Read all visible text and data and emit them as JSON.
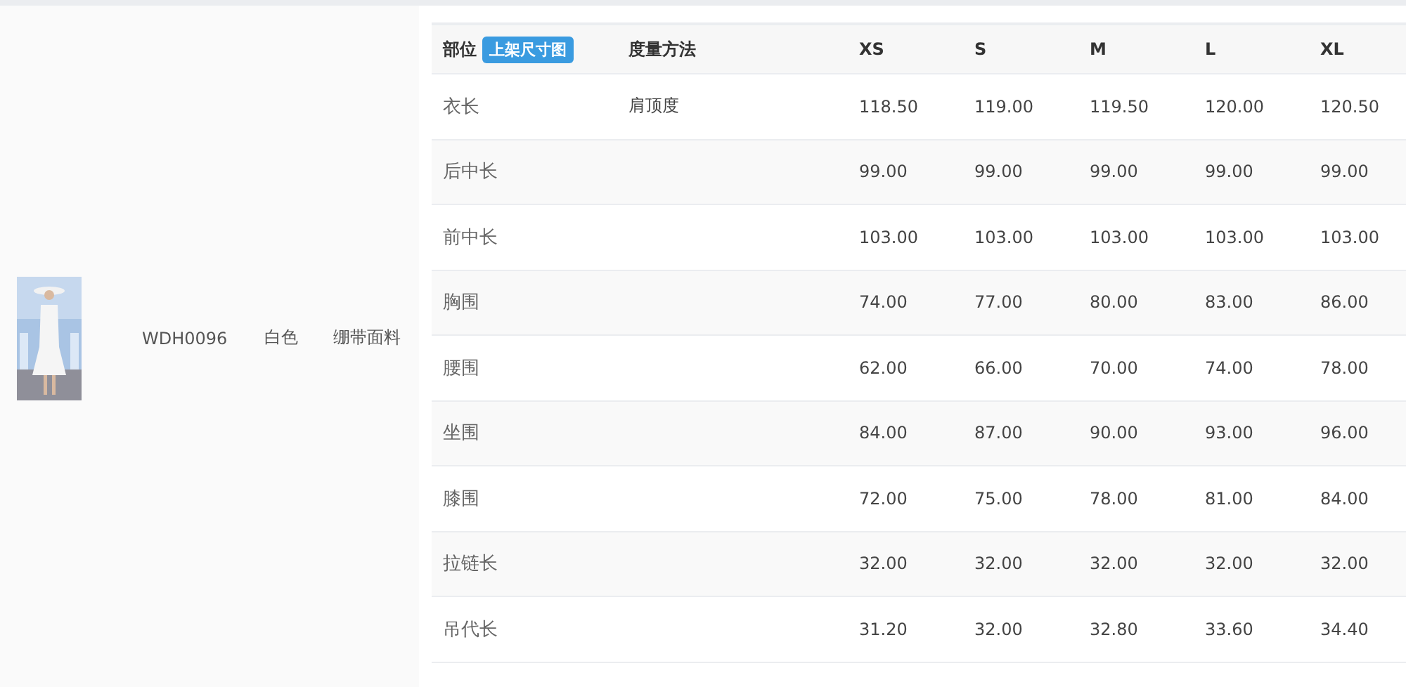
{
  "product": {
    "code": "WDH0096",
    "variant": "白色",
    "fabric": "绷带面料"
  },
  "table": {
    "columns": [
      {
        "label": "部位",
        "badge": "上架尺寸图"
      },
      {
        "label": "度量方法"
      },
      {
        "label": "XS"
      },
      {
        "label": "S"
      },
      {
        "label": "M"
      },
      {
        "label": "L"
      },
      {
        "label": "XL"
      }
    ],
    "rows": [
      {
        "part": "衣长",
        "method": "肩顶度",
        "values": [
          "118.50",
          "119.00",
          "119.50",
          "120.00",
          "120.50"
        ]
      },
      {
        "part": "后中长",
        "values": [
          "99.00",
          "99.00",
          "99.00",
          "99.00",
          "99.00"
        ]
      },
      {
        "part": "前中长",
        "values": [
          "103.00",
          "103.00",
          "103.00",
          "103.00",
          "103.00"
        ]
      },
      {
        "part": "胸围",
        "values": [
          "74.00",
          "77.00",
          "80.00",
          "83.00",
          "86.00"
        ]
      },
      {
        "part": "腰围",
        "values": [
          "62.00",
          "66.00",
          "70.00",
          "74.00",
          "78.00"
        ]
      },
      {
        "part": "坐围",
        "values": [
          "84.00",
          "87.00",
          "90.00",
          "93.00",
          "96.00"
        ]
      },
      {
        "part": "膝围",
        "values": [
          "72.00",
          "75.00",
          "78.00",
          "81.00",
          "84.00"
        ]
      },
      {
        "part": "拉链长",
        "values": [
          "32.00",
          "32.00",
          "32.00",
          "32.00",
          "32.00"
        ]
      },
      {
        "part": "吊代长",
        "values": [
          "31.20",
          "32.00",
          "32.80",
          "33.60",
          "34.40"
        ]
      }
    ]
  }
}
